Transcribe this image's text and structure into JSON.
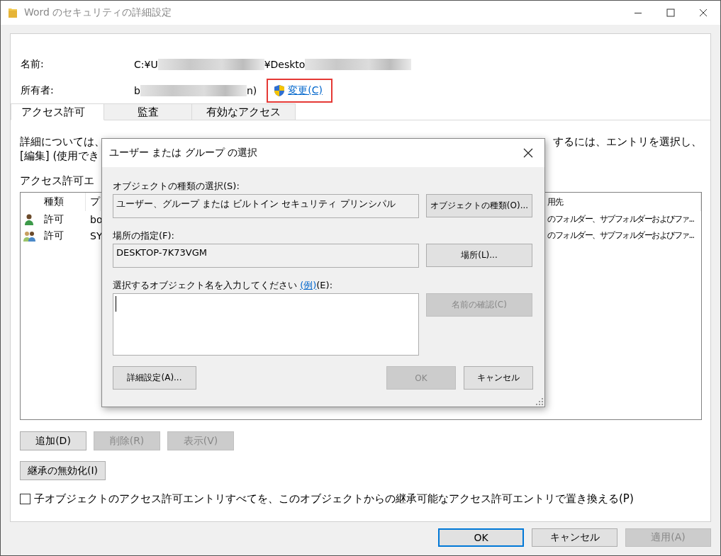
{
  "window": {
    "title": "Word のセキュリティの詳細設定"
  },
  "header": [
    {
      "label": "名前:",
      "parts": [
        {
          "kind": "text",
          "text": "C:¥U"
        },
        {
          "kind": "blur"
        },
        {
          "kind": "text",
          "text": "¥Deskto"
        },
        {
          "kind": "blur"
        }
      ]
    },
    {
      "label": "所有者:",
      "parts": [
        {
          "kind": "text",
          "text": "b"
        },
        {
          "kind": "blur"
        },
        {
          "kind": "text",
          "text": "n)"
        }
      ],
      "link": {
        "label": "変更(C)",
        "highlighted": true
      }
    }
  ],
  "tabs": [
    {
      "label": "アクセス許可",
      "selected": true
    },
    {
      "label": "監査",
      "selected": false
    },
    {
      "label": "有効なアクセス",
      "selected": false
    }
  ],
  "info": [
    {
      "left": "詳細については、",
      "right": "するには、エントリを選択し、"
    },
    {
      "left": "[編集] (使用でき"
    }
  ],
  "list_label": "アクセス許可エ",
  "table": {
    "columns": [
      "種類",
      "プ",
      "用先"
    ],
    "rows": [
      {
        "kind": "user",
        "type": "許可",
        "principal": "bo",
        "applies_to": "のフォルダー、サブフォルダーおよびファ..."
      },
      {
        "kind": "group",
        "type": "許可",
        "principal": "SY",
        "applies_to": "のフォルダー、サブフォルダーおよびファ..."
      }
    ]
  },
  "entry_buttons": [
    {
      "label": "追加(D)",
      "disabled": false
    },
    {
      "label": "削除(R)",
      "disabled": true
    },
    {
      "label": "表示(V)",
      "disabled": true
    }
  ],
  "inherit_button": {
    "label": "継承の無効化(I)"
  },
  "replace_checkbox": {
    "label": "子オブジェクトのアクセス許可エントリすべてを、このオブジェクトからの継承可能なアクセス許可エントリで置き換える(P)",
    "checked": false
  },
  "footer_buttons": [
    {
      "label": "OK",
      "default": true,
      "disabled": false
    },
    {
      "label": "キャンセル",
      "default": false,
      "disabled": false
    },
    {
      "label": "適用(A)",
      "default": false,
      "disabled": true
    }
  ],
  "dialog": {
    "title": "ユーザー または グループ の選択",
    "object_type": {
      "label": "オブジェクトの種類の選択(S):",
      "value": "ユーザー、グループ または ビルトイン セキュリティ プリンシパル",
      "button": {
        "label": "オブジェクトの種類(O)...",
        "disabled": false
      }
    },
    "location": {
      "label": "場所の指定(F):",
      "value": "DESKTOP-7K73VGM",
      "button": {
        "label": "場所(L)...",
        "disabled": false
      }
    },
    "names": {
      "label_before": "選択するオブジェクト名を入力してください ",
      "link": "(例)",
      "label_after": "(E):",
      "focused": true,
      "button": {
        "label": "名前の確認(C)",
        "disabled": true
      }
    },
    "buttons": [
      {
        "label": "詳細設定(A)...",
        "disabled": false,
        "kind": "left"
      },
      {
        "label": "OK",
        "disabled": true,
        "kind": "right"
      },
      {
        "label": "キャンセル",
        "disabled": false,
        "kind": "right"
      }
    ]
  }
}
